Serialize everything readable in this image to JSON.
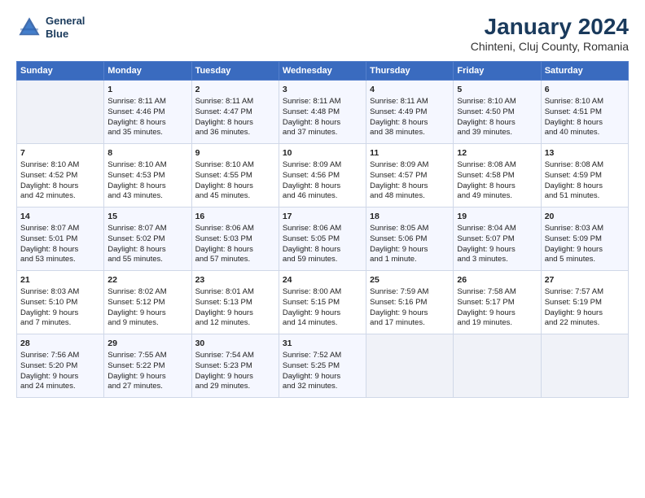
{
  "header": {
    "logo_line1": "General",
    "logo_line2": "Blue",
    "main_title": "January 2024",
    "sub_title": "Chinteni, Cluj County, Romania"
  },
  "days_of_week": [
    "Sunday",
    "Monday",
    "Tuesday",
    "Wednesday",
    "Thursday",
    "Friday",
    "Saturday"
  ],
  "weeks": [
    [
      {
        "day": "",
        "content": ""
      },
      {
        "day": "1",
        "content": "Sunrise: 8:11 AM\nSunset: 4:46 PM\nDaylight: 8 hours\nand 35 minutes."
      },
      {
        "day": "2",
        "content": "Sunrise: 8:11 AM\nSunset: 4:47 PM\nDaylight: 8 hours\nand 36 minutes."
      },
      {
        "day": "3",
        "content": "Sunrise: 8:11 AM\nSunset: 4:48 PM\nDaylight: 8 hours\nand 37 minutes."
      },
      {
        "day": "4",
        "content": "Sunrise: 8:11 AM\nSunset: 4:49 PM\nDaylight: 8 hours\nand 38 minutes."
      },
      {
        "day": "5",
        "content": "Sunrise: 8:10 AM\nSunset: 4:50 PM\nDaylight: 8 hours\nand 39 minutes."
      },
      {
        "day": "6",
        "content": "Sunrise: 8:10 AM\nSunset: 4:51 PM\nDaylight: 8 hours\nand 40 minutes."
      }
    ],
    [
      {
        "day": "7",
        "content": "Sunrise: 8:10 AM\nSunset: 4:52 PM\nDaylight: 8 hours\nand 42 minutes."
      },
      {
        "day": "8",
        "content": "Sunrise: 8:10 AM\nSunset: 4:53 PM\nDaylight: 8 hours\nand 43 minutes."
      },
      {
        "day": "9",
        "content": "Sunrise: 8:10 AM\nSunset: 4:55 PM\nDaylight: 8 hours\nand 45 minutes."
      },
      {
        "day": "10",
        "content": "Sunrise: 8:09 AM\nSunset: 4:56 PM\nDaylight: 8 hours\nand 46 minutes."
      },
      {
        "day": "11",
        "content": "Sunrise: 8:09 AM\nSunset: 4:57 PM\nDaylight: 8 hours\nand 48 minutes."
      },
      {
        "day": "12",
        "content": "Sunrise: 8:08 AM\nSunset: 4:58 PM\nDaylight: 8 hours\nand 49 minutes."
      },
      {
        "day": "13",
        "content": "Sunrise: 8:08 AM\nSunset: 4:59 PM\nDaylight: 8 hours\nand 51 minutes."
      }
    ],
    [
      {
        "day": "14",
        "content": "Sunrise: 8:07 AM\nSunset: 5:01 PM\nDaylight: 8 hours\nand 53 minutes."
      },
      {
        "day": "15",
        "content": "Sunrise: 8:07 AM\nSunset: 5:02 PM\nDaylight: 8 hours\nand 55 minutes."
      },
      {
        "day": "16",
        "content": "Sunrise: 8:06 AM\nSunset: 5:03 PM\nDaylight: 8 hours\nand 57 minutes."
      },
      {
        "day": "17",
        "content": "Sunrise: 8:06 AM\nSunset: 5:05 PM\nDaylight: 8 hours\nand 59 minutes."
      },
      {
        "day": "18",
        "content": "Sunrise: 8:05 AM\nSunset: 5:06 PM\nDaylight: 9 hours\nand 1 minute."
      },
      {
        "day": "19",
        "content": "Sunrise: 8:04 AM\nSunset: 5:07 PM\nDaylight: 9 hours\nand 3 minutes."
      },
      {
        "day": "20",
        "content": "Sunrise: 8:03 AM\nSunset: 5:09 PM\nDaylight: 9 hours\nand 5 minutes."
      }
    ],
    [
      {
        "day": "21",
        "content": "Sunrise: 8:03 AM\nSunset: 5:10 PM\nDaylight: 9 hours\nand 7 minutes."
      },
      {
        "day": "22",
        "content": "Sunrise: 8:02 AM\nSunset: 5:12 PM\nDaylight: 9 hours\nand 9 minutes."
      },
      {
        "day": "23",
        "content": "Sunrise: 8:01 AM\nSunset: 5:13 PM\nDaylight: 9 hours\nand 12 minutes."
      },
      {
        "day": "24",
        "content": "Sunrise: 8:00 AM\nSunset: 5:15 PM\nDaylight: 9 hours\nand 14 minutes."
      },
      {
        "day": "25",
        "content": "Sunrise: 7:59 AM\nSunset: 5:16 PM\nDaylight: 9 hours\nand 17 minutes."
      },
      {
        "day": "26",
        "content": "Sunrise: 7:58 AM\nSunset: 5:17 PM\nDaylight: 9 hours\nand 19 minutes."
      },
      {
        "day": "27",
        "content": "Sunrise: 7:57 AM\nSunset: 5:19 PM\nDaylight: 9 hours\nand 22 minutes."
      }
    ],
    [
      {
        "day": "28",
        "content": "Sunrise: 7:56 AM\nSunset: 5:20 PM\nDaylight: 9 hours\nand 24 minutes."
      },
      {
        "day": "29",
        "content": "Sunrise: 7:55 AM\nSunset: 5:22 PM\nDaylight: 9 hours\nand 27 minutes."
      },
      {
        "day": "30",
        "content": "Sunrise: 7:54 AM\nSunset: 5:23 PM\nDaylight: 9 hours\nand 29 minutes."
      },
      {
        "day": "31",
        "content": "Sunrise: 7:52 AM\nSunset: 5:25 PM\nDaylight: 9 hours\nand 32 minutes."
      },
      {
        "day": "",
        "content": ""
      },
      {
        "day": "",
        "content": ""
      },
      {
        "day": "",
        "content": ""
      }
    ]
  ]
}
